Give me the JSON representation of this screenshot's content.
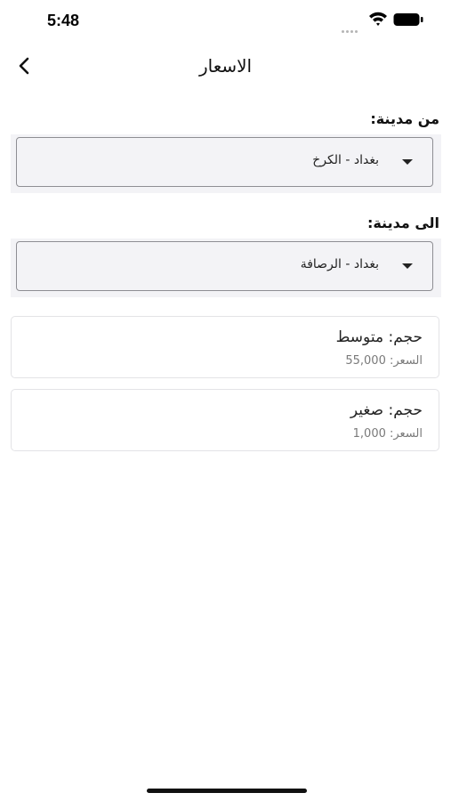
{
  "status_bar": {
    "time": "5:48"
  },
  "nav": {
    "title": "الاسعار",
    "back_icon": "chevron-left-icon"
  },
  "from_city": {
    "label": "من مدينة:",
    "selected": "بغداد - الكرخ"
  },
  "to_city": {
    "label": "الى مدينة:",
    "selected": "بغداد - الرصافة"
  },
  "prices": [
    {
      "size": "حجم: متوسط",
      "price": "السعر: 55,000"
    },
    {
      "size": "حجم: صغير",
      "price": "السعر: 1,000"
    }
  ]
}
